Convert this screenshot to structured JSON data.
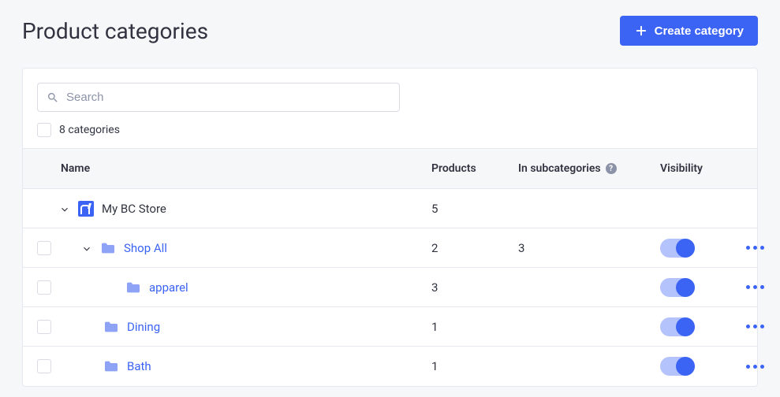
{
  "header": {
    "title": "Product categories",
    "create_button": "Create category"
  },
  "search": {
    "placeholder": "Search"
  },
  "summary": {
    "count_label": "8 categories"
  },
  "columns": {
    "name": "Name",
    "products": "Products",
    "subcategories": "In subcategories",
    "visibility": "Visibility"
  },
  "rows": [
    {
      "label": "My BC Store",
      "products": "5",
      "subcategories": ""
    },
    {
      "label": "Shop All",
      "products": "2",
      "subcategories": "3"
    },
    {
      "label": "apparel",
      "products": "3",
      "subcategories": ""
    },
    {
      "label": "Dining",
      "products": "1",
      "subcategories": ""
    },
    {
      "label": "Bath",
      "products": "1",
      "subcategories": ""
    }
  ]
}
